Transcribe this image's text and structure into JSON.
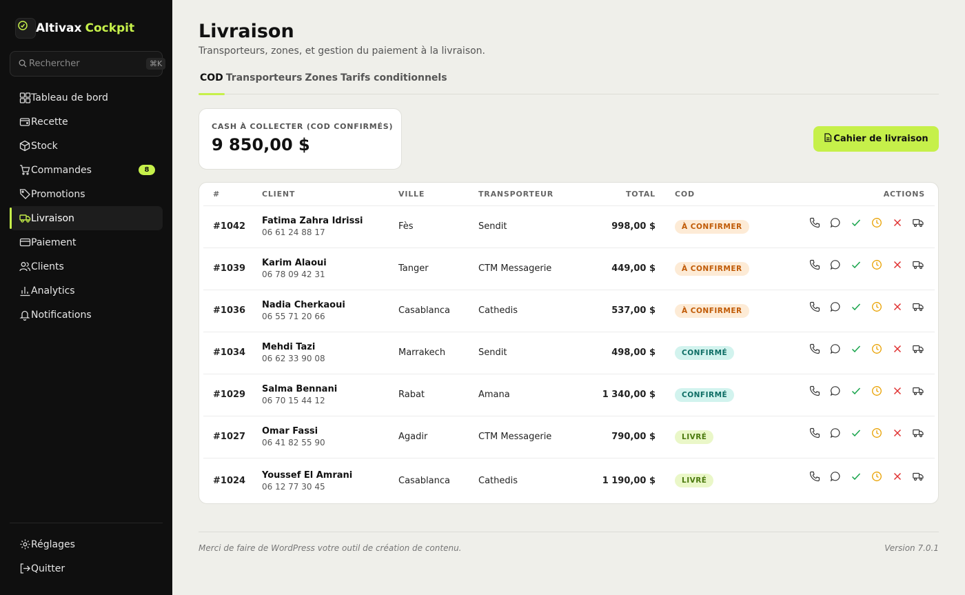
{
  "brand": {
    "name": "Altivax",
    "accent": "Cockpit"
  },
  "search": {
    "placeholder": "Rechercher",
    "shortcut": "⌘K"
  },
  "sidebar": {
    "items": [
      {
        "label": "Tableau de bord",
        "icon": "dashboard-icon"
      },
      {
        "label": "Recette",
        "icon": "wallet-icon"
      },
      {
        "label": "Stock",
        "icon": "box-icon"
      },
      {
        "label": "Commandes",
        "icon": "cart-icon",
        "badge": "8"
      },
      {
        "label": "Promotions",
        "icon": "tag-icon"
      },
      {
        "label": "Livraison",
        "icon": "truck-icon",
        "active": true
      },
      {
        "label": "Paiement",
        "icon": "credit-card-icon"
      },
      {
        "label": "Clients",
        "icon": "users-icon"
      },
      {
        "label": "Analytics",
        "icon": "bar-chart-icon"
      },
      {
        "label": "Notifications",
        "icon": "bell-icon"
      }
    ],
    "bottom": [
      {
        "label": "Réglages",
        "icon": "gear-icon"
      },
      {
        "label": "Quitter",
        "icon": "logout-icon"
      }
    ]
  },
  "page": {
    "title": "Livraison",
    "subtitle": "Transporteurs, zones, et gestion du paiement à la livraison."
  },
  "tabs": [
    {
      "label": "COD",
      "active": true
    },
    {
      "label": "Transporteurs"
    },
    {
      "label": "Zones"
    },
    {
      "label": "Tarifs conditionnels"
    }
  ],
  "cash": {
    "label": "CASH À COLLECTER (COD CONFIRMÉS)",
    "value": "9 850,00 $"
  },
  "cahier_button": "Cahier de livraison",
  "table": {
    "headers": {
      "id": "#",
      "client": "CLIENT",
      "ville": "VILLE",
      "transporteur": "TRANSPORTEUR",
      "total": "TOTAL",
      "cod": "COD",
      "actions": "ACTIONS"
    },
    "rows": [
      {
        "id": "#1042",
        "name": "Fatima Zahra Idrissi",
        "phone": "06 61 24 88 17",
        "ville": "Fès",
        "transporteur": "Sendit",
        "total": "998,00 $",
        "cod": "À CONFIRMER",
        "status": "pending"
      },
      {
        "id": "#1039",
        "name": "Karim Alaoui",
        "phone": "06 78 09 42 31",
        "ville": "Tanger",
        "transporteur": "CTM Messagerie",
        "total": "449,00 $",
        "cod": "À CONFIRMER",
        "status": "pending"
      },
      {
        "id": "#1036",
        "name": "Nadia Cherkaoui",
        "phone": "06 55 71 20 66",
        "ville": "Casablanca",
        "transporteur": "Cathedis",
        "total": "537,00 $",
        "cod": "À CONFIRMER",
        "status": "pending"
      },
      {
        "id": "#1034",
        "name": "Mehdi Tazi",
        "phone": "06 62 33 90 08",
        "ville": "Marrakech",
        "transporteur": "Sendit",
        "total": "498,00 $",
        "cod": "CONFIRMÉ",
        "status": "confirmed"
      },
      {
        "id": "#1029",
        "name": "Salma Bennani",
        "phone": "06 70 15 44 12",
        "ville": "Rabat",
        "transporteur": "Amana",
        "total": "1 340,00 $",
        "cod": "CONFIRMÉ",
        "status": "confirmed"
      },
      {
        "id": "#1027",
        "name": "Omar Fassi",
        "phone": "06 41 82 55 90",
        "ville": "Agadir",
        "transporteur": "CTM Messagerie",
        "total": "790,00 $",
        "cod": "LIVRÉ",
        "status": "delivered"
      },
      {
        "id": "#1024",
        "name": "Youssef El Amrani",
        "phone": "06 12 77 30 45",
        "ville": "Casablanca",
        "transporteur": "Cathedis",
        "total": "1 190,00 $",
        "cod": "LIVRÉ",
        "status": "delivered"
      }
    ]
  },
  "colors": {
    "accent": "#c6f04a",
    "sidebar_bg": "#0f0f0f",
    "page_bg": "#efefea",
    "pending": "#c05a05",
    "confirmed": "#0d6d64",
    "delivered": "#4b7a0e",
    "check": "#16a34a",
    "clock": "#e9a100",
    "cross": "#e03131"
  },
  "footer": {
    "left": "Merci de faire de WordPress votre outil de création de contenu.",
    "right": "Version 7.0.1"
  }
}
